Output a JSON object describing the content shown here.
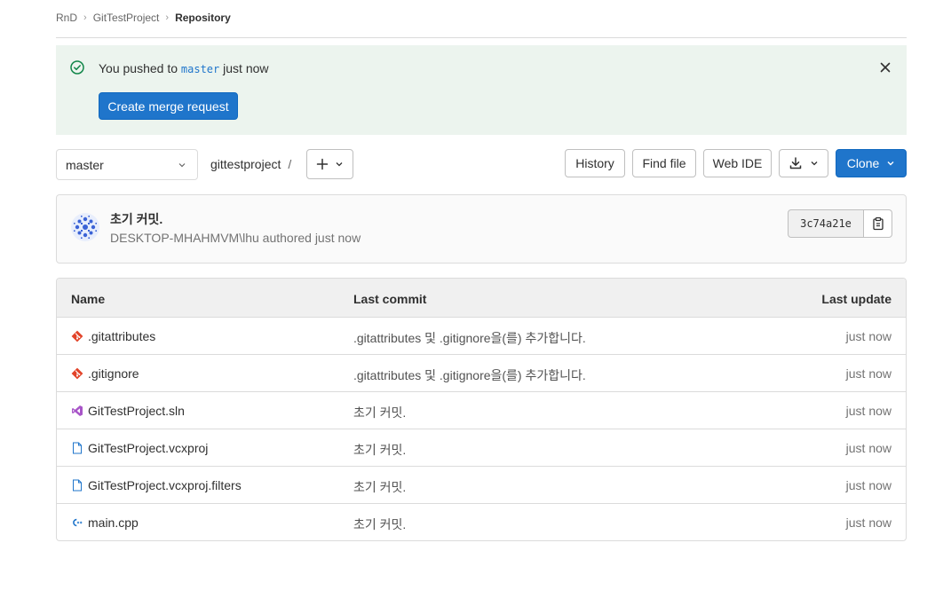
{
  "breadcrumb": {
    "items": [
      "RnD",
      "GitTestProject"
    ],
    "current": "Repository"
  },
  "alert": {
    "message_prefix": "You pushed to",
    "branch": "master",
    "message_suffix": "just now",
    "button_label": "Create merge request"
  },
  "toolbar": {
    "branch": "master",
    "path": "gittestproject",
    "path_sep": "/",
    "history_label": "History",
    "find_file_label": "Find file",
    "web_ide_label": "Web IDE",
    "clone_label": "Clone"
  },
  "commit": {
    "title": "초기 커밋.",
    "author_line": "DESKTOP-MHAHMVM\\lhu authored just now",
    "sha": "3c74a21e"
  },
  "table": {
    "headers": {
      "name": "Name",
      "last_commit": "Last commit",
      "last_update": "Last update"
    },
    "rows": [
      {
        "icon": "git-file-icon",
        "name": ".gitattributes",
        "commit": ".gitattributes 및 .gitignore을(를) 추가합니다.",
        "updated": "just now"
      },
      {
        "icon": "git-file-icon",
        "name": ".gitignore",
        "commit": ".gitattributes 및 .gitignore을(를) 추가합니다.",
        "updated": "just now"
      },
      {
        "icon": "visual-studio-icon",
        "name": "GitTestProject.sln",
        "commit": "초기 커밋.",
        "updated": "just now"
      },
      {
        "icon": "file-icon",
        "name": "GitTestProject.vcxproj",
        "commit": "초기 커밋.",
        "updated": "just now"
      },
      {
        "icon": "file-icon",
        "name": "GitTestProject.vcxproj.filters",
        "commit": "초기 커밋.",
        "updated": "just now"
      },
      {
        "icon": "cpp-icon",
        "name": "main.cpp",
        "commit": "초기 커밋.",
        "updated": "just now"
      }
    ]
  },
  "colors": {
    "primary": "#1f75cb",
    "alert_bg": "#ecf4ee",
    "success_icon": "#108548",
    "git_icon": "#e24329",
    "vs_icon": "#a855c8",
    "file_icon": "#1f75cb"
  }
}
